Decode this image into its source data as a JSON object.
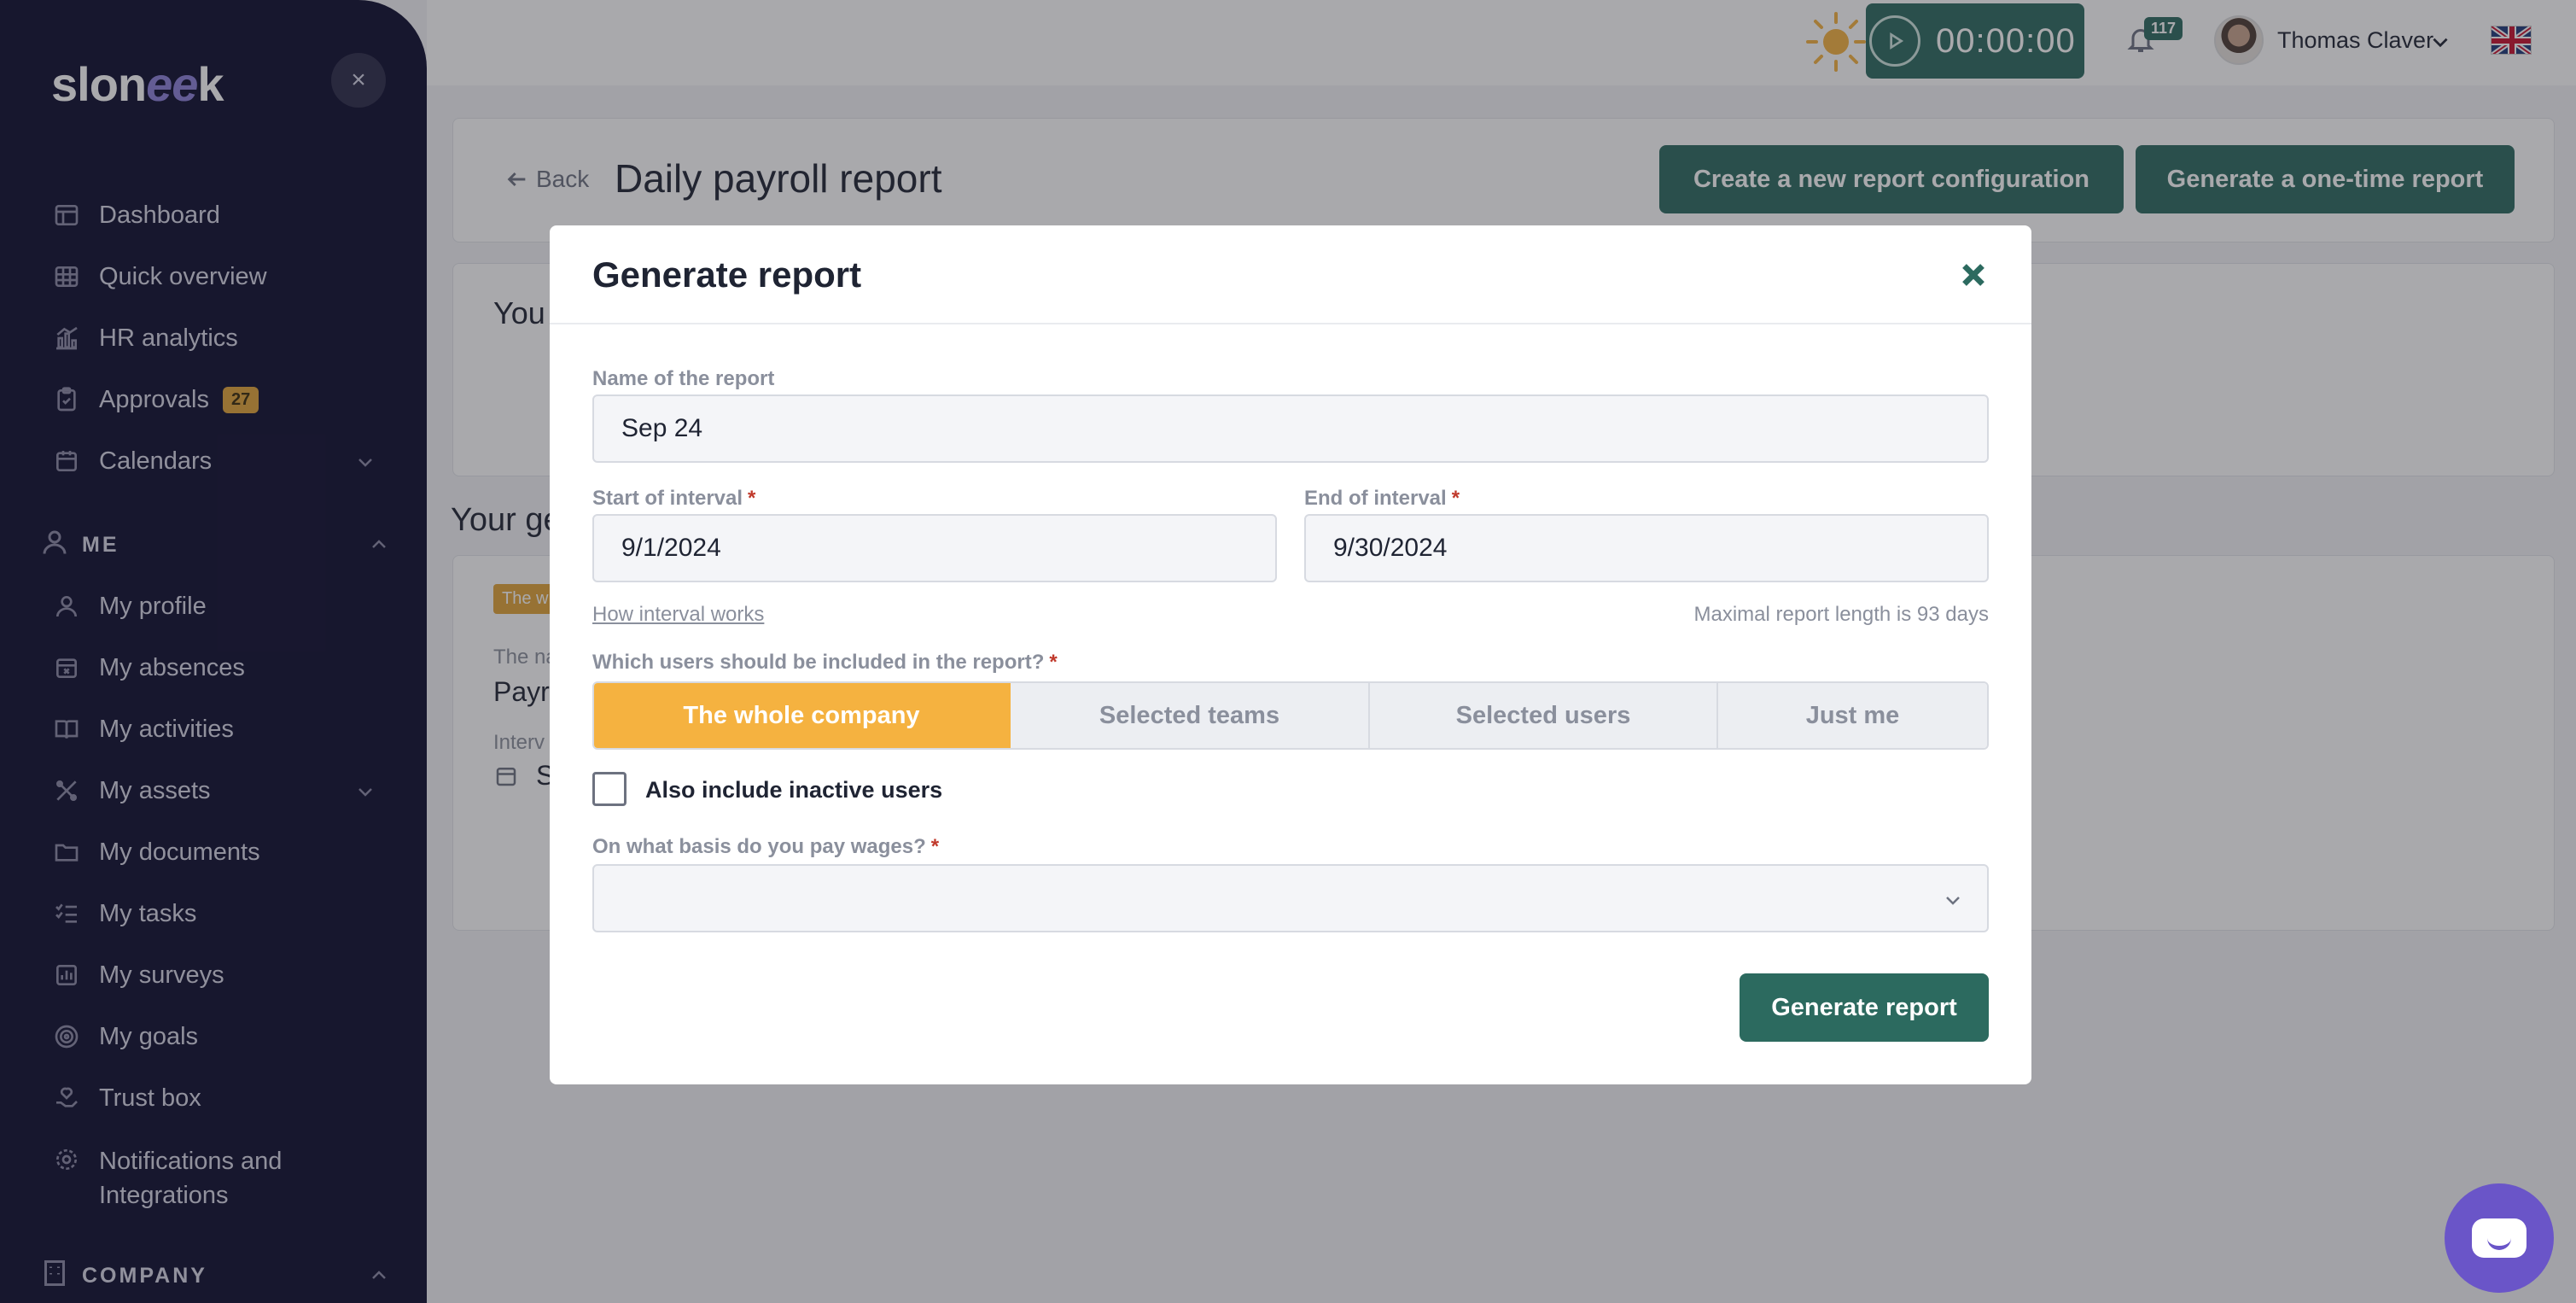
{
  "app": {
    "logo": "slon",
    "logo_accent": "ee",
    "logo_end": "k"
  },
  "sidebar": {
    "items": [
      {
        "label": "Dashboard"
      },
      {
        "label": "Quick overview"
      },
      {
        "label": "HR analytics"
      },
      {
        "label": "Approvals",
        "badge": "27"
      },
      {
        "label": "Calendars"
      },
      {
        "label": "My profile"
      },
      {
        "label": "My absences"
      },
      {
        "label": "My activities"
      },
      {
        "label": "My assets"
      },
      {
        "label": "My documents"
      },
      {
        "label": "My tasks"
      },
      {
        "label": "My surveys"
      },
      {
        "label": "My goals"
      },
      {
        "label": "Trust box"
      },
      {
        "label": "Notifications and",
        "label2": "Integrations"
      }
    ],
    "sections": {
      "me": "ME",
      "company": "COMPANY"
    }
  },
  "topbar": {
    "timer": "00:00:00",
    "notifications": "117",
    "user_name": "Thomas Claver"
  },
  "page": {
    "back": "Back",
    "title": "Daily payroll report",
    "btn_new_config": "Create a new report configuration",
    "btn_one_time": "Generate a one-time report",
    "card2_title": "You",
    "section_title": "Your ge",
    "tag": "The w",
    "name_label": "The na",
    "name_value": "Payro",
    "interval_label": "Interv",
    "interval_value": "S"
  },
  "modal": {
    "title": "Generate report",
    "name_label": "Name of the report",
    "name_value": "Sep 24",
    "start_label": "Start of interval",
    "start_value": "9/1/2024",
    "end_label": "End of interval",
    "end_value": "9/30/2024",
    "req": "*",
    "how_link": "How interval works",
    "max_note": "Maximal report length is 93 days",
    "users_label": "Which users should be included in the report?",
    "segments": [
      {
        "label": "The whole company",
        "active": true
      },
      {
        "label": "Selected teams",
        "active": false
      },
      {
        "label": "Selected users",
        "active": false
      },
      {
        "label": "Just me",
        "active": false
      }
    ],
    "inactive_label": "Also include inactive users",
    "wages_label": "On what basis do you pay wages?",
    "wages_value": "",
    "submit": "Generate report"
  },
  "colors": {
    "sidebar_bg": "#0d0c2e",
    "primary": "#2c6a5f",
    "accent": "#f5b240",
    "badge": "#e1a437",
    "chat": "#6a55c8"
  }
}
